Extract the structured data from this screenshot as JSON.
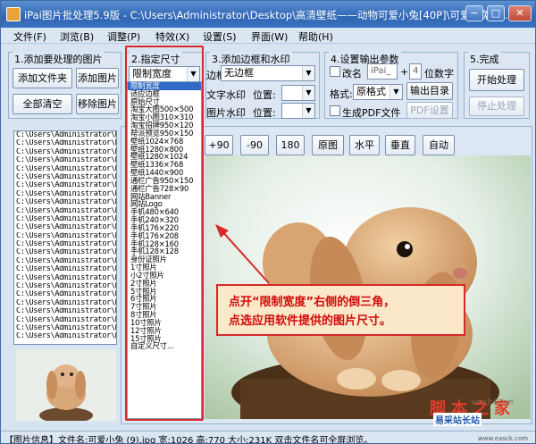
{
  "window": {
    "title": "iPai图片批处理5.9版 - C:\\Users\\Administrator\\Desktop\\高清壁纸——动物可爱小兔[40P]\\可爱小兔 (1..."
  },
  "menu": [
    "文件(F)",
    "浏览(B)",
    "调整(P)",
    "特效(X)",
    "设置(S)",
    "界面(W)",
    "帮助(H)"
  ],
  "section1": {
    "title": "1.添加要处理的图片",
    "add_folder": "添加文件夹",
    "add_image": "添加图片",
    "clear_all": "全部清空",
    "remove_image": "移除图片"
  },
  "section2": {
    "title": "2.指定尺寸",
    "selected": "限制宽度"
  },
  "section3": {
    "title": "3.添加边框和水印",
    "border_label": "边框:",
    "border_value": "无边框",
    "text_watermark": "文字水印",
    "image_watermark": "图片水印",
    "position_label": "位置:"
  },
  "section4": {
    "title": "4.设置输出参数",
    "rename_label": "改名",
    "name_value": "iPai_",
    "plus": "+",
    "digits_value": "4",
    "digits_label": "位数字",
    "format_label": "格式:",
    "format_value": "原格式",
    "output_dir": "输出目录",
    "gen_pdf": "生成PDF文件",
    "pdf_settings": "PDF设置"
  },
  "section5": {
    "title": "5.完成",
    "start": "开始处理",
    "stop": "停止处理"
  },
  "rotate_buttons": [
    "+90",
    "-90",
    "180",
    "原图",
    "水平",
    "垂直",
    "自动"
  ],
  "file_items": [
    "C:\\Users\\Administrator\\D",
    "C:\\Users\\Administrator\\D",
    "C:\\Users\\Administrator\\D",
    "C:\\Users\\Administrator\\D",
    "C:\\Users\\Administrator\\D",
    "C:\\Users\\Administrator\\D",
    "C:\\Users\\Administrator\\D",
    "C:\\Users\\Administrator\\D",
    "C:\\Users\\Administrator\\D",
    "C:\\Users\\Administrator\\D",
    "C:\\Users\\Administrator\\D",
    "C:\\Users\\Administrator\\D",
    "C:\\Users\\Administrator\\D",
    "C:\\Users\\Administrator\\D",
    "C:\\Users\\Administrator\\D",
    "C:\\Users\\Administrator\\D",
    "C:\\Users\\Administrator\\D",
    "C:\\Users\\Administrator\\D",
    "C:\\Users\\Administrator\\D",
    "C:\\Users\\Administrator\\D",
    "C:\\Users\\Administrator\\D",
    "C:\\Users\\Administrator\\D",
    "C:\\Users\\Administrator\\D",
    "C:\\Users\\Administrator\\D",
    "C:\\Users\\Administrator\\D"
  ],
  "size_options": [
    "限制宽度",
    "适应边框",
    "原始尺寸",
    "淘宝大图500×500",
    "淘宝小图310×310",
    "淘宝招牌950×120",
    "帮派预览950×150",
    "壁纸1024×768",
    "壁纸1280×800",
    "壁纸1280×1024",
    "壁纸1336×768",
    "壁纸1440×900",
    "通栏广告950×150",
    "通栏广告728×90",
    "网站Banner",
    "网站Logo",
    "手机480×640",
    "手机240×320",
    "手机176×220",
    "手机176×208",
    "手机128×160",
    "手机128×128",
    "身份证照片",
    "1寸照片",
    "小2寸照片",
    "2寸照片",
    "5寸照片",
    "6寸照片",
    "7寸照片",
    "8寸照片",
    "10寸照片",
    "12寸照片",
    "15寸照片",
    "自定义尺寸..."
  ],
  "callout": {
    "line1": "点开“限制宽度”右侧的倒三角，",
    "line2": "点选应用软件提供的图片尺寸。"
  },
  "status": {
    "text": "【图片信息】文件名:可爱小兔 (9).jpg  宽:1026  高:770  大小:231K   双击文件名可全屏浏览。"
  },
  "watermark": {
    "text1": "脚本之家",
    "text2": "易采站长站",
    "url": "www.easck.com",
    "url2": "www.jb51.net"
  },
  "colors": {
    "accent": "#3169c6",
    "highlight": "#d8282a",
    "callout_bg": "#fbe8c8"
  }
}
